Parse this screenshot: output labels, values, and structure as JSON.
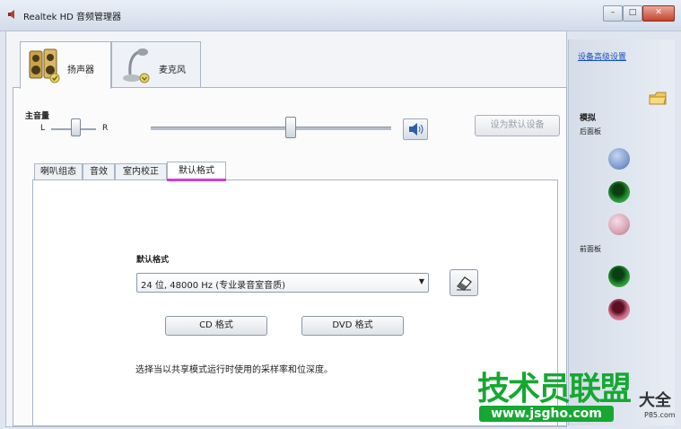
{
  "window": {
    "title": "Realtek HD 音频管理器"
  },
  "device_tabs": [
    {
      "label": "扬声器",
      "icon": "speaker-icon",
      "active": true
    },
    {
      "label": "麦克风",
      "icon": "microphone-icon",
      "active": false
    }
  ],
  "volume": {
    "title": "主音量",
    "balance_left": "L",
    "balance_right": "R",
    "set_default_button": "设为默认设备"
  },
  "sub_tabs": [
    {
      "label": "喇叭组态",
      "active": false
    },
    {
      "label": "音效",
      "active": false
    },
    {
      "label": "室内校正",
      "active": false
    },
    {
      "label": "默认格式",
      "active": true
    }
  ],
  "default_format": {
    "label": "默认格式",
    "selected": "24 位, 48000 Hz (专业录音室音质)",
    "cd_button": "CD 格式",
    "dvd_button": "DVD 格式",
    "description": "选择当以共享模式运行时使用的采样率和位深度。"
  },
  "right_pane": {
    "advanced_link": "设备高级设置",
    "analog": "模拟",
    "rear_panel": "后面板",
    "front_panel": "前面板"
  },
  "watermark": {
    "line1": "技术员联盟",
    "line2": "www.jsgho.com",
    "side": "大全",
    "small": "P85.com"
  },
  "colors": {
    "accent_tab_underline": "#d63bd3",
    "jack_blue": "#7f9ccf",
    "jack_green": "#1f8b2c",
    "jack_pink": "#d9a3b3",
    "jack_pink_front": "#c7657f"
  }
}
